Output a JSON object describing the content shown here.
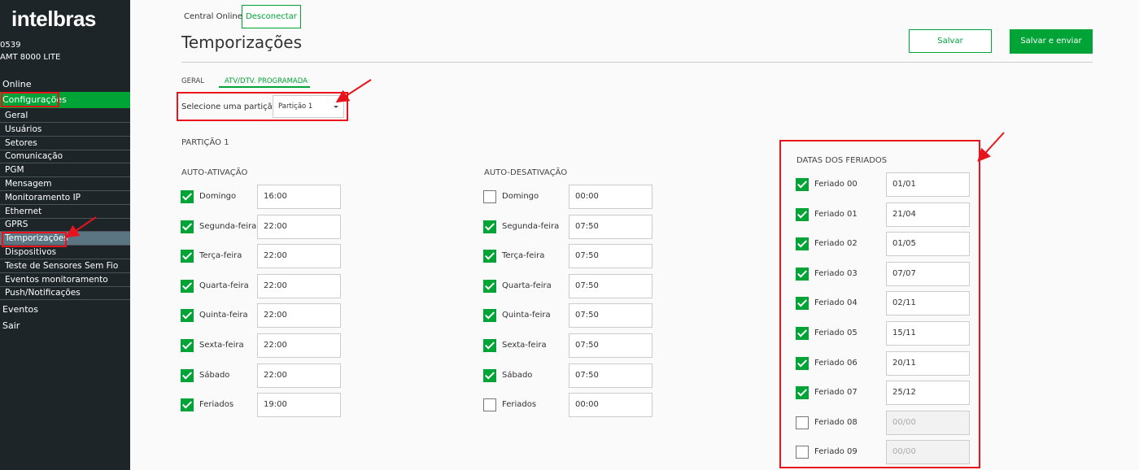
{
  "brand": "intelbras",
  "device": {
    "id": "0539",
    "model": "AMT 8000 LITE"
  },
  "nav": {
    "online": "Online",
    "config": "Configurações",
    "sub": [
      "Geral",
      "Usuários",
      "Setores",
      "Comunicação",
      "PGM",
      "Mensagem",
      "Monitoramento IP",
      "Ethernet",
      "GPRS",
      "Temporizações",
      "Dispositivos",
      "Teste de Sensores Sem Fio",
      "Eventos monitoramento",
      "Push/Notificações"
    ],
    "active_sub": "Temporizações",
    "events": "Eventos",
    "exit": "Sair"
  },
  "header": {
    "central_label": "Central Online:",
    "disconnect": "Desconectar",
    "title": "Temporizações",
    "save": "Salvar",
    "save_send": "Salvar e enviar"
  },
  "tabs": [
    "GERAL",
    "ATV/DTV. PROGRAMADA"
  ],
  "active_tab": "ATV/DTV. PROGRAMADA",
  "partition_select": {
    "label": "Selecione uma partição",
    "value": "Partição 1"
  },
  "partition_title": "PARTIÇÃO 1",
  "auto_on": {
    "title": "AUTO-ATIVAÇÃO",
    "rows": [
      {
        "label": "Domingo",
        "checked": true,
        "time": "16:00"
      },
      {
        "label": "Segunda-feira",
        "checked": true,
        "time": "22:00"
      },
      {
        "label": "Terça-feira",
        "checked": true,
        "time": "22:00"
      },
      {
        "label": "Quarta-feira",
        "checked": true,
        "time": "22:00"
      },
      {
        "label": "Quinta-feira",
        "checked": true,
        "time": "22:00"
      },
      {
        "label": "Sexta-feira",
        "checked": true,
        "time": "22:00"
      },
      {
        "label": "Sábado",
        "checked": true,
        "time": "22:00"
      },
      {
        "label": "Feriados",
        "checked": true,
        "time": "19:00"
      }
    ]
  },
  "auto_off": {
    "title": "AUTO-DESATIVAÇÃO",
    "rows": [
      {
        "label": "Domingo",
        "checked": false,
        "time": "00:00"
      },
      {
        "label": "Segunda-feira",
        "checked": true,
        "time": "07:50"
      },
      {
        "label": "Terça-feira",
        "checked": true,
        "time": "07:50"
      },
      {
        "label": "Quarta-feira",
        "checked": true,
        "time": "07:50"
      },
      {
        "label": "Quinta-feira",
        "checked": true,
        "time": "07:50"
      },
      {
        "label": "Sexta-feira",
        "checked": true,
        "time": "07:50"
      },
      {
        "label": "Sábado",
        "checked": true,
        "time": "07:50"
      },
      {
        "label": "Feriados",
        "checked": false,
        "time": "00:00"
      }
    ]
  },
  "holidays": {
    "title": "DATAS DOS FERIADOS",
    "rows": [
      {
        "label": "Feriado 00",
        "checked": true,
        "date": "01/01"
      },
      {
        "label": "Feriado 01",
        "checked": true,
        "date": "21/04"
      },
      {
        "label": "Feriado 02",
        "checked": true,
        "date": "01/05"
      },
      {
        "label": "Feriado 03",
        "checked": true,
        "date": "07/07"
      },
      {
        "label": "Feriado 04",
        "checked": true,
        "date": "02/11"
      },
      {
        "label": "Feriado 05",
        "checked": true,
        "date": "15/11"
      },
      {
        "label": "Feriado 06",
        "checked": true,
        "date": "20/11"
      },
      {
        "label": "Feriado 07",
        "checked": true,
        "date": "25/12"
      },
      {
        "label": "Feriado 08",
        "checked": false,
        "date": "00/00"
      },
      {
        "label": "Feriado 09",
        "checked": false,
        "date": "00/00"
      }
    ]
  },
  "colors": {
    "accent": "#00a335",
    "sidebar": "#1d2529",
    "annotation": "#e8131b"
  }
}
